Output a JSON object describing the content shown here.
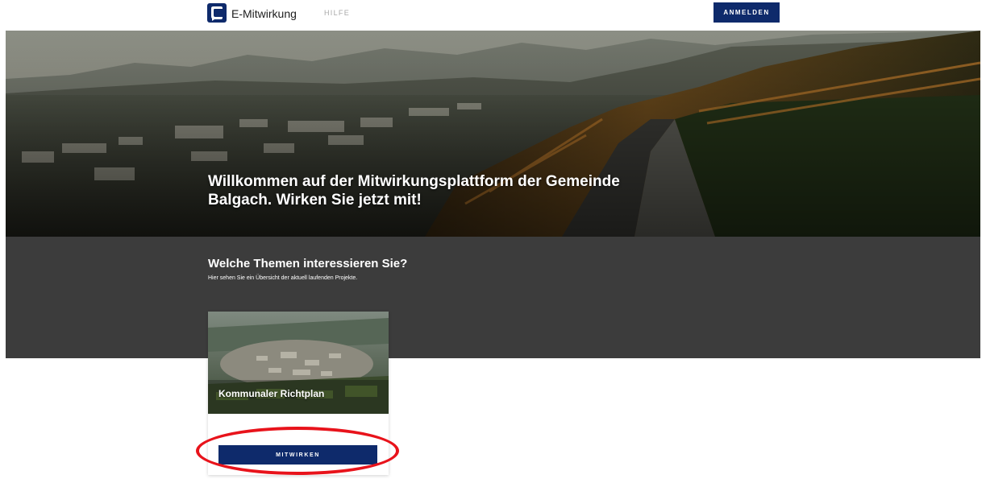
{
  "header": {
    "brand_name": "E-Mitwirkung",
    "nav_help": "HILFE",
    "login_label": "ANMELDEN",
    "brand_color": "#0e2a6b",
    "logo_icon": "speech-bubble-icon"
  },
  "hero": {
    "title": "Willkommen auf der Mitwirkungsplattform der Gemeinde Balgach. Wirken Sie jetzt mit!"
  },
  "themes": {
    "title": "Welche Themen interessieren Sie?",
    "subtitle": "Hier sehen Sie ein Übersicht der aktuell laufenden Projekte.",
    "projects": [
      {
        "title": "Kommunaler Richtplan",
        "button_label": "MITWIRKEN"
      }
    ]
  },
  "annotation": {
    "highlight_color": "#e8131b"
  }
}
